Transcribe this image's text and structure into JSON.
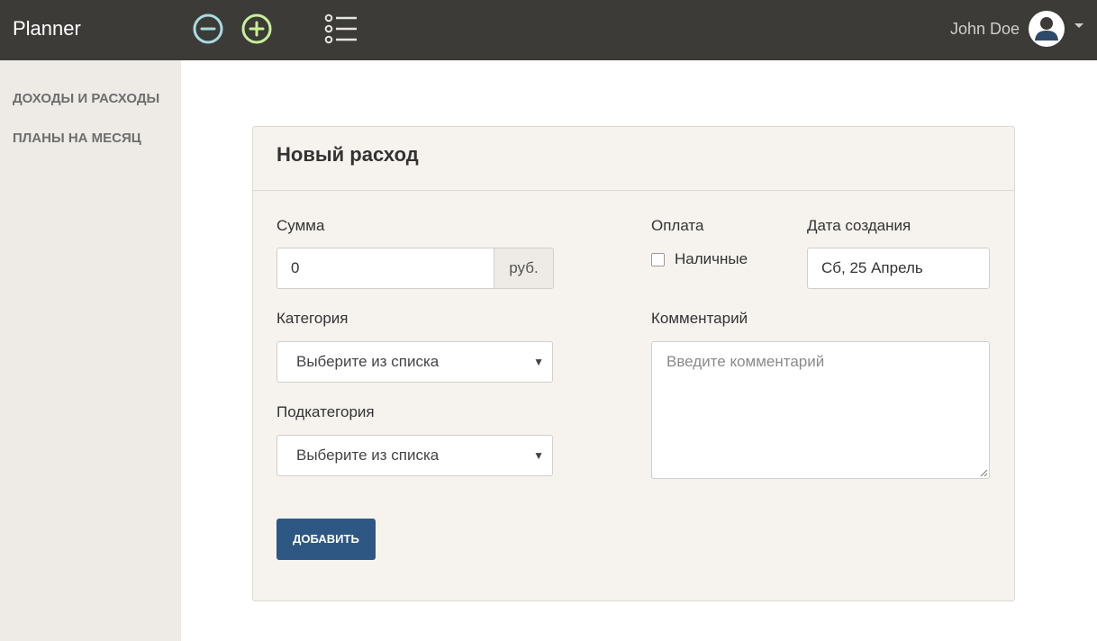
{
  "app": {
    "title": "Planner"
  },
  "header": {
    "icons": [
      "minus-circle-icon",
      "plus-circle-icon",
      "list-icon"
    ],
    "user_name": "John Doe"
  },
  "sidebar": {
    "items": [
      {
        "label": "ДОХОДЫ И РАСХОДЫ"
      },
      {
        "label": "ПЛАНЫ НА МЕСЯЦ"
      }
    ]
  },
  "form": {
    "title": "Новый расход",
    "amount": {
      "label": "Сумма",
      "value": "0",
      "unit": "руб."
    },
    "category": {
      "label": "Категория",
      "selected": "Выберите из списка"
    },
    "subcategory": {
      "label": "Подкатегория",
      "selected": "Выберите из списка"
    },
    "payment": {
      "label": "Оплата",
      "option_label": "Наличные",
      "checked": false
    },
    "date": {
      "label": "Дата создания",
      "value": "Сб, 25 Апрель"
    },
    "comment": {
      "label": "Комментарий",
      "placeholder": "Введите комментарий"
    },
    "submit_label": "ДОБАВИТЬ"
  },
  "colors": {
    "topbar": "#3c3b37",
    "sidebar": "#eeebe7",
    "panel": "#f6f3ef",
    "primary_button": "#2e5783",
    "minus_icon": "#a9dbe0",
    "plus_icon": "#c9ef9a"
  }
}
